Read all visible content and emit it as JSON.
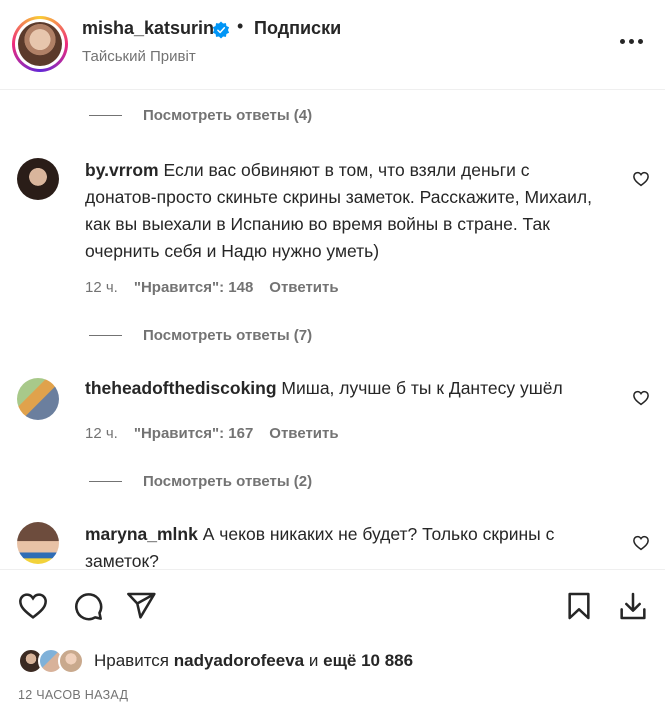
{
  "header": {
    "username": "misha_katsurin",
    "separator": "•",
    "follow_label": "Подписки",
    "subtitle": "Тайський Привіт",
    "more_icon": "more-horizontal-icon",
    "verified_icon": "verified-badge-icon"
  },
  "comments": {
    "view_replies": [
      "Посмотреть ответы (4)",
      "Посмотреть ответы (7)",
      "Посмотреть ответы (2)"
    ],
    "items": [
      {
        "username": "by.vrrom",
        "text": "Если вас обвиняют в том, что взяли деньги с донатов-просто скиньте скрины заметок. Расскажите, Михаил, как вы выехали в Испанию во время войны в стране. Так очернить себя и Надю нужно уметь)",
        "time": "12 ч.",
        "likes": "\"Нравится\": 148",
        "reply_label": "Ответить"
      },
      {
        "username": "theheadofthediscoking",
        "text": "Миша, лучше б ты к Дантесу ушёл",
        "time": "12 ч.",
        "likes": "\"Нравится\": 167",
        "reply_label": "Ответить"
      },
      {
        "username": "maryna_mlnk",
        "text": "А чеков никаких не будет? Только скрины с заметок?",
        "time": "",
        "likes": "",
        "reply_label": ""
      }
    ]
  },
  "footer": {
    "likes_prefix": "Нравится",
    "likes_user": "nadyadorofeeva",
    "likes_and": "и",
    "likes_more": "ещё 10 886",
    "time_ago": "12 ЧАСОВ НАЗАД",
    "icons": [
      "heart-icon",
      "comment-icon",
      "share-icon",
      "bookmark-icon",
      "download-icon"
    ]
  }
}
